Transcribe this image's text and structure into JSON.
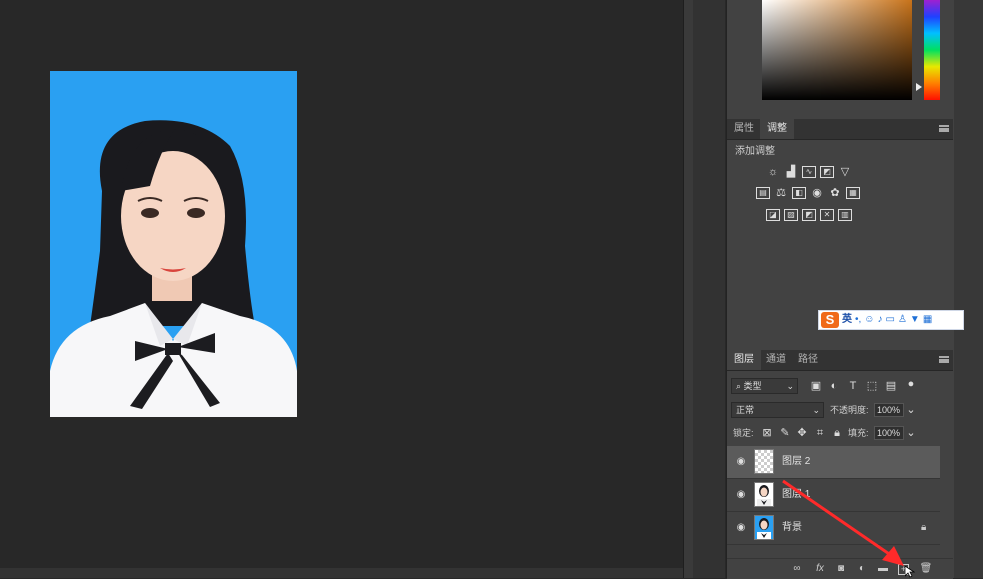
{
  "app": {
    "theme_color": "#282828",
    "panel_color": "#424242"
  },
  "adjustments_panel": {
    "tabs": [
      {
        "label": "属性",
        "active": false
      },
      {
        "label": "调整",
        "active": true
      }
    ],
    "section_label": "添加调整",
    "row1_icons": [
      "brightness-contrast-icon",
      "levels-icon",
      "curves-icon",
      "exposure-icon",
      "vibrance-triangle-icon"
    ],
    "row2_icons": [
      "hue-saturation-icon",
      "color-balance-icon",
      "black-white-icon",
      "photo-filter-icon",
      "channel-mixer-icon",
      "color-lookup-icon"
    ],
    "row3_icons": [
      "invert-icon",
      "posterize-icon",
      "threshold-icon",
      "selective-color-icon",
      "gradient-map-icon"
    ]
  },
  "ime_bar": {
    "logo": "S",
    "lang": "英",
    "brand_color": "#f06a1a"
  },
  "layers_panel": {
    "tabs": [
      {
        "label": "图层",
        "active": true
      },
      {
        "label": "通道",
        "active": false
      },
      {
        "label": "路径",
        "active": false
      }
    ],
    "filter_label": "类型",
    "blend_mode": "正常",
    "opacity_label": "不透明度:",
    "opacity_value": "100%",
    "lock_label": "锁定:",
    "fill_label": "填充:",
    "fill_value": "100%",
    "layers": [
      {
        "name": "图层 2",
        "selected": true,
        "thumb": "transparent",
        "locked": false
      },
      {
        "name": "图层 1",
        "selected": false,
        "thumb": "portrait",
        "locked": false
      },
      {
        "name": "背景",
        "selected": false,
        "thumb": "portrait",
        "locked": true
      }
    ]
  },
  "photo": {
    "background_color": "#2a9cf0"
  },
  "annotation": {
    "arrow_color": "#ff2a2a"
  }
}
